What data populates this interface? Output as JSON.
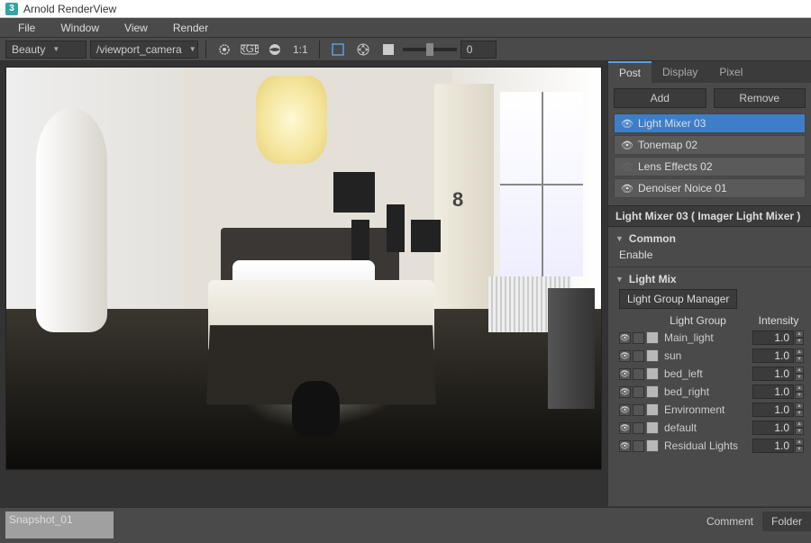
{
  "window": {
    "title": "Arnold RenderView"
  },
  "menubar": {
    "items": [
      "File",
      "Window",
      "View",
      "Render"
    ]
  },
  "toolbar": {
    "aov_dropdown": "Beauty",
    "camera_dropdown": "/viewport_camera",
    "ratio_label": "1:1",
    "slider_value": "0"
  },
  "panel": {
    "tabs": {
      "post": "Post",
      "display": "Display",
      "pixel": "Pixel"
    },
    "buttons": {
      "add": "Add",
      "remove": "Remove"
    },
    "imagers": [
      {
        "label": "Light Mixer 03",
        "eye": true,
        "selected": true
      },
      {
        "label": "Tonemap 02",
        "eye": true,
        "selected": false
      },
      {
        "label": "Lens Effects 02",
        "eye": false,
        "selected": false
      },
      {
        "label": "Denoiser Noice 01",
        "eye": true,
        "selected": false
      }
    ],
    "section_title": "Light Mixer 03  ( Imager Light Mixer )",
    "common": {
      "title": "Common",
      "enable_label": "Enable"
    },
    "lightmix": {
      "title": "Light Mix",
      "manager_btn": "Light Group Manager",
      "header": {
        "group": "Light Group",
        "intensity": "Intensity"
      },
      "rows": [
        {
          "name": "Main_light",
          "intensity": "1.0"
        },
        {
          "name": "sun",
          "intensity": "1.0"
        },
        {
          "name": "bed_left",
          "intensity": "1.0"
        },
        {
          "name": "bed_right",
          "intensity": "1.0"
        },
        {
          "name": "Environment",
          "intensity": "1.0"
        },
        {
          "name": "default",
          "intensity": "1.0"
        },
        {
          "name": "Residual Lights",
          "intensity": "1.0"
        }
      ]
    }
  },
  "footer": {
    "snapshot_label": "Snapshot_01",
    "tabs": {
      "comment": "Comment",
      "folder": "Folder"
    }
  }
}
